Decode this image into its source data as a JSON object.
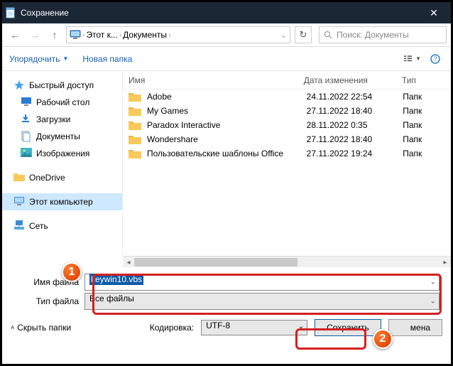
{
  "window": {
    "title": "Сохранение"
  },
  "nav": {
    "breadcrumb": [
      "Этот к...",
      "Документы"
    ],
    "search_placeholder": "Поиск: Документы"
  },
  "toolbar": {
    "organize": "Упорядочить",
    "new_folder": "Новая папка"
  },
  "sidebar": {
    "quick_access": "Быстрый доступ",
    "desktop": "Рабочий стол",
    "downloads": "Загрузки",
    "documents": "Документы",
    "pictures": "Изображения",
    "onedrive": "OneDrive",
    "this_pc": "Этот компьютер",
    "network": "Сеть"
  },
  "columns": {
    "name": "Имя",
    "date": "Дата изменения",
    "type": "Тип"
  },
  "files": [
    {
      "name": "Adobe",
      "date": "24.11.2022 22:54",
      "type": "Папк"
    },
    {
      "name": "My Games",
      "date": "27.11.2022 18:40",
      "type": "Папк"
    },
    {
      "name": "Paradox Interactive",
      "date": "28.11.2022 0:35",
      "type": "Папк"
    },
    {
      "name": "Wondershare",
      "date": "27.11.2022 18:40",
      "type": "Папк"
    },
    {
      "name": "Пользовательские шаблоны Office",
      "date": "27.11.2022 19:24",
      "type": "Папк"
    }
  ],
  "form": {
    "filename_label": "Имя файла",
    "filename_value": "keywin10.vbs",
    "filetype_label": "Тип файла",
    "filetype_value": "Все файлы"
  },
  "bottom": {
    "hide_folders": "Скрыть папки",
    "encoding_label": "Кодировка:",
    "encoding_value": "UTF-8",
    "save": "Сохранить",
    "cancel_suffix": "мена"
  },
  "badges": {
    "one": "1",
    "two": "2"
  }
}
